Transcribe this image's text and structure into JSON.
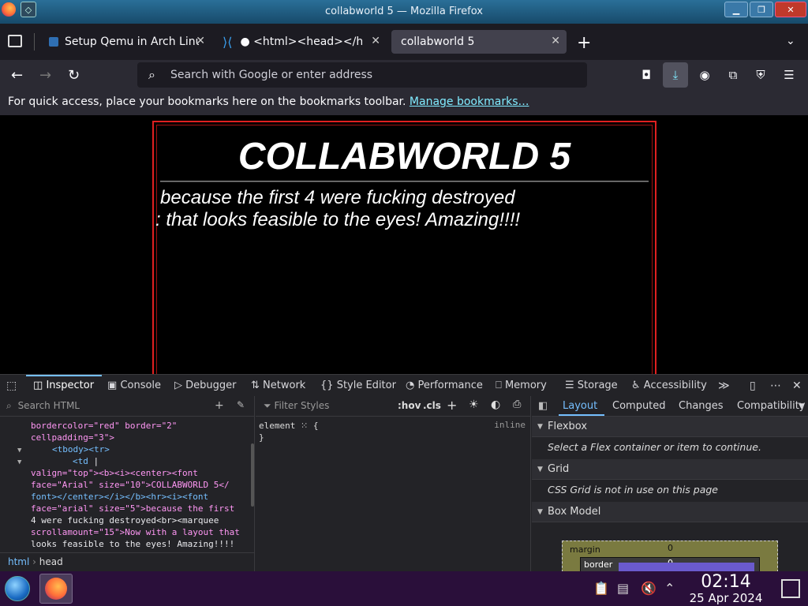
{
  "window": {
    "title": "collabworld 5 — Mozilla Firefox",
    "controls": [
      "minimize",
      "maximize",
      "close"
    ]
  },
  "tabs": [
    {
      "label": "Setup Qemu in Arch Linu",
      "icon": "qemu-favicon"
    },
    {
      "label": "● <html><head></hea",
      "icon": "vscode-favicon"
    },
    {
      "label": "collabworld 5",
      "icon": "",
      "active": true
    }
  ],
  "navbar": {
    "search_placeholder": "Search with Google or enter address"
  },
  "bookmarks": {
    "message": "For quick access, place your bookmarks here on the bookmarks toolbar.",
    "link": "Manage bookmarks…"
  },
  "page": {
    "title": "COLLABWORLD 5",
    "line1": "because the first 4 were fucking destroyed",
    "marquee": ": that looks feasible to the eyes! Amazing!!!!",
    "border_color": "#e02020"
  },
  "devtools": {
    "tabs": [
      "Inspector",
      "Console",
      "Debugger",
      "Network",
      "Style Editor",
      "Performance",
      "Memory",
      "Storage",
      "Accessibility"
    ],
    "search_html_placeholder": "Search HTML",
    "code_lines": [
      "bordercolor=\"red\" border=\"2\"",
      "cellpadding=\"3\">",
      "<tbody><tr>",
      "<td",
      "valign=\"top\"><b><i><center><font",
      "face=\"Arial\" size=\"10\">COLLABWORLD 5</",
      "font></center></i></b><hr><i><font",
      "face=\"arial\" size=\"5\">because the first",
      "4 were fucking destroyed<br><marquee",
      "scrollamount=\"15\">Now with a layout that",
      "looks feasible to the eyes! Amazing!!!!"
    ],
    "breadcrumbs": [
      "html",
      "head"
    ],
    "filter_placeholder": "Filter Styles",
    "filter_buttons": [
      ":hov",
      ".cls"
    ],
    "rule_selector": "element",
    "rule_source": "inline",
    "right_tabs": [
      "Layout",
      "Computed",
      "Changes",
      "Compatibility"
    ],
    "sections": [
      {
        "title": "Flexbox",
        "message": "Select a Flex container or item to continue."
      },
      {
        "title": "Grid",
        "message": "CSS Grid is not in use on this page"
      },
      {
        "title": "Box Model",
        "message": ""
      }
    ],
    "box_model": {
      "margin_label": "margin",
      "margin_value": "0",
      "border_label": "border",
      "border_value": "0"
    }
  },
  "taskbar": {
    "time": "02:14",
    "date": "25 Apr 2024"
  }
}
